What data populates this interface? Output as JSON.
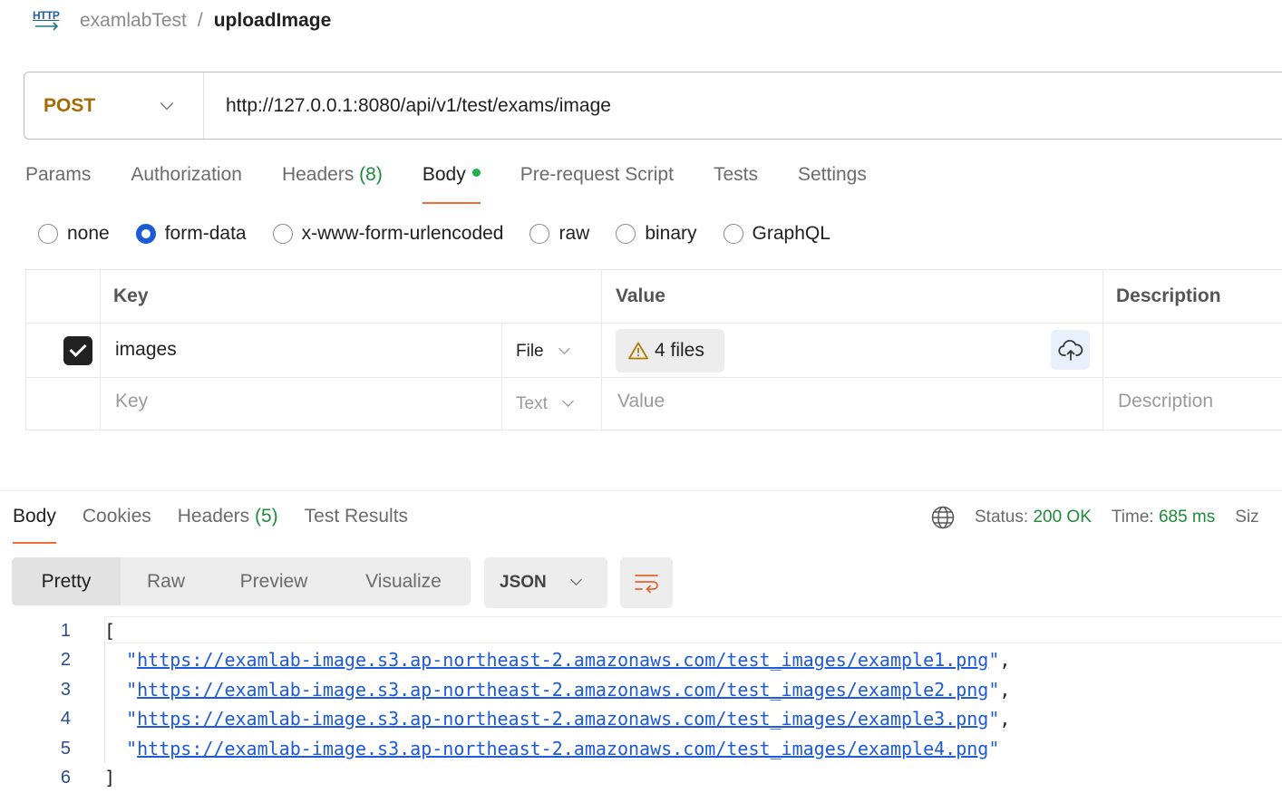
{
  "breadcrumb": {
    "icon_label": "HTTP",
    "collection": "examlabTest",
    "separator": "/",
    "request": "uploadImage"
  },
  "request": {
    "method": "POST",
    "url": "http://127.0.0.1:8080/api/v1/test/exams/image"
  },
  "request_tabs": {
    "params": "Params",
    "authorization": "Authorization",
    "headers": "Headers",
    "headers_count": "(8)",
    "body": "Body",
    "prerequest": "Pre-request Script",
    "tests": "Tests",
    "settings": "Settings"
  },
  "body_types": [
    "none",
    "form-data",
    "x-www-form-urlencoded",
    "raw",
    "binary",
    "GraphQL"
  ],
  "body_type_selected": "form-data",
  "form_table": {
    "headers": {
      "key": "Key",
      "value": "Value",
      "description": "Description"
    },
    "rows": [
      {
        "checked": true,
        "key": "images",
        "type": "File",
        "value": "4 files"
      }
    ],
    "placeholder_row": {
      "key": "Key",
      "type": "Text",
      "value": "Value",
      "description": "Description"
    }
  },
  "response_tabs": {
    "body": "Body",
    "cookies": "Cookies",
    "headers": "Headers",
    "headers_count": "(5)",
    "test_results": "Test Results"
  },
  "response_status": {
    "status_label": "Status:",
    "status_value": "200 OK",
    "time_label": "Time:",
    "time_value": "685 ms",
    "size_label": "Siz"
  },
  "view_modes": [
    "Pretty",
    "Raw",
    "Preview",
    "Visualize"
  ],
  "language": "JSON",
  "code": {
    "line_numbers": [
      "1",
      "2",
      "3",
      "4",
      "5",
      "6"
    ],
    "open": "[",
    "close": "]",
    "urls": [
      "https://examlab-image.s3.ap-northeast-2.amazonaws.com/test_images/example1.png",
      "https://examlab-image.s3.ap-northeast-2.amazonaws.com/test_images/example2.png",
      "https://examlab-image.s3.ap-northeast-2.amazonaws.com/test_images/example3.png",
      "https://examlab-image.s3.ap-northeast-2.amazonaws.com/test_images/example4.png"
    ]
  },
  "colors": {
    "accent": "#f26b3a",
    "method": "#a66b00",
    "link": "#1d5ad8",
    "success": "#1e8a3a"
  }
}
